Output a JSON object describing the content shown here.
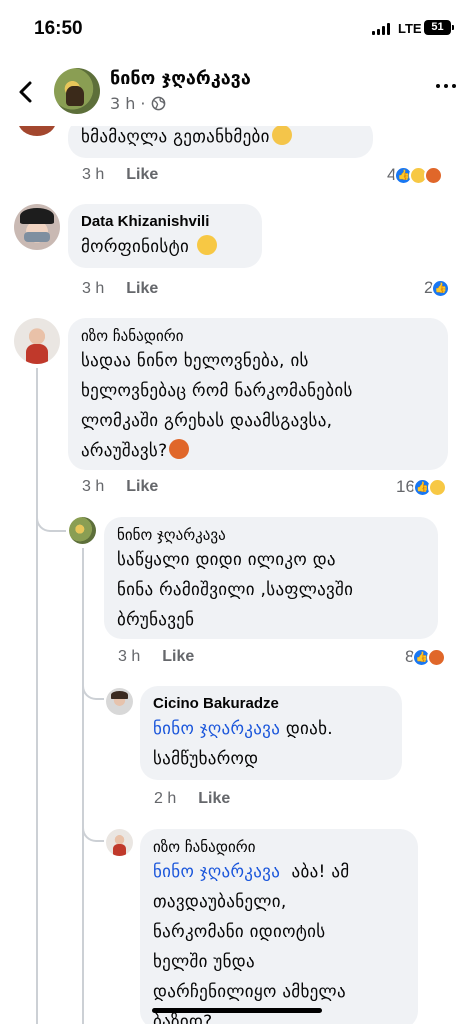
{
  "status_bar": {
    "time": "16:50",
    "network": "LTE",
    "battery": "51"
  },
  "header": {
    "name": "ნინო ჯღარკავა",
    "time": "3 h",
    "privacy_icon": "globe-icon"
  },
  "comments": [
    {
      "id": "c0",
      "text": "ხმამაღლა გეთანხმები",
      "emoji": "clapping-hands",
      "time": "3 h",
      "like_label": "Like",
      "reaction_count": "4"
    },
    {
      "id": "c1",
      "author": "Data Khizanishvili",
      "text": "მორფინისტი",
      "emoji": "rolling-laughing",
      "time": "3 h",
      "like_label": "Like",
      "reaction_count": "2"
    },
    {
      "id": "c2",
      "author": "იზო ჩანადირი",
      "lines": [
        "სადაა ნინო ხელოვნება, ის",
        "ხელოვნებაც რომ ნარკომანების",
        "ლომკაში გრეხას დაამსგავსა,",
        "არაუშავს?"
      ],
      "emoji": "angry-face",
      "time": "3 h",
      "like_label": "Like",
      "reaction_count": "16"
    },
    {
      "id": "r1",
      "author": "ნინო ჯღარკავა",
      "lines": [
        "საწყალი დიდი ილიკო და",
        "ნინა რამიშვილი ,საფლავში",
        "ბრუნავენ"
      ],
      "time": "3 h",
      "like_label": "Like",
      "reaction_count": "8"
    },
    {
      "id": "r2",
      "author": "Cicino Bakuradze",
      "mention": "ნინო ჯღარკავა",
      "after_mention": " დიახ.",
      "lines": [
        "სამწუხაროდ"
      ],
      "time": "2 h",
      "like_label": "Like"
    },
    {
      "id": "r3",
      "author": "იზო ჩანადირი",
      "mention": "ნინო ჯღარკავა",
      "after_mention": "  აბა! ამ",
      "lines": [
        "თავდაუბანელი,",
        "ნარკომანი იდიოტის",
        "ხელში უნდა",
        "დარჩენილიყო ამხელა",
        "ბაზიდ?"
      ]
    }
  ],
  "colors": {
    "bubble": "#f0f2f5",
    "meta": "#65676b",
    "mention": "#1a56db",
    "like_reaction": "#1877f2"
  }
}
